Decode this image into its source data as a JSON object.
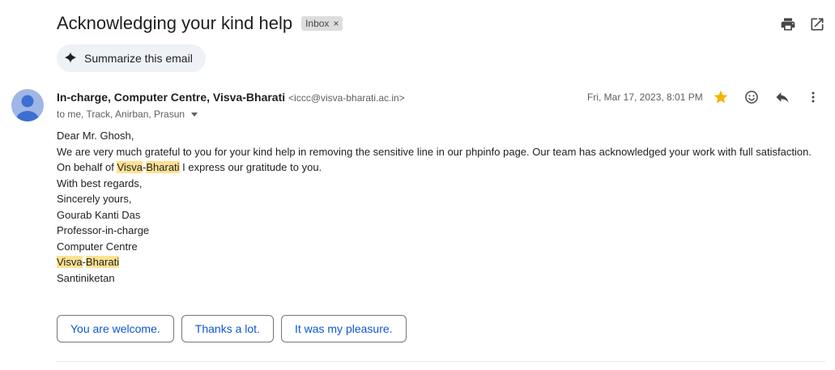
{
  "email": {
    "subject": "Acknowledging your kind help",
    "label": "Inbox",
    "label_close": "×",
    "summarize_label": "Summarize this email",
    "sender_name": "In-charge, Computer Centre, Visva-Bharati",
    "sender_email": "<iccc@visva-bharati.ac.in>",
    "recipients": "to me, Track, Anirban, Prasun",
    "date": "Fri, Mar 17, 2023, 8:01 PM",
    "starred": true,
    "body": {
      "l1": "Dear Mr. Ghosh,",
      "l2": "We are very much grateful to you for your kind help in removing the sensitive line in our phpinfo page. Our team has acknowledged your work with full satisfaction.",
      "l3_before": "On behalf of ",
      "l3_hl_a": "Visva",
      "l3_hyphen": "-",
      "l3_hl_b": "Bharati",
      "l3_after": " I express our gratitude to you.",
      "l4": "With best regards,",
      "l5": "Sincerely yours,",
      "l6": "Gourab Kanti Das",
      "l7": "Professor-in-charge",
      "l8": "Computer Centre",
      "l9_hl_a": "Visva",
      "l9_hyphen": "-",
      "l9_hl_b": "Bharati",
      "l10": "Santiniketan"
    }
  },
  "smart_replies": [
    "You are welcome.",
    "Thanks a lot.",
    "It was my pleasure."
  ],
  "icons": [
    "print-icon",
    "open-in-new-window-icon",
    "sparkle-icon",
    "star-icon",
    "emoji-icon",
    "reply-icon",
    "more-vert-icon"
  ],
  "colors": {
    "star": "#f4b400",
    "highlight": "#fde293",
    "link": "#0b57d0"
  }
}
